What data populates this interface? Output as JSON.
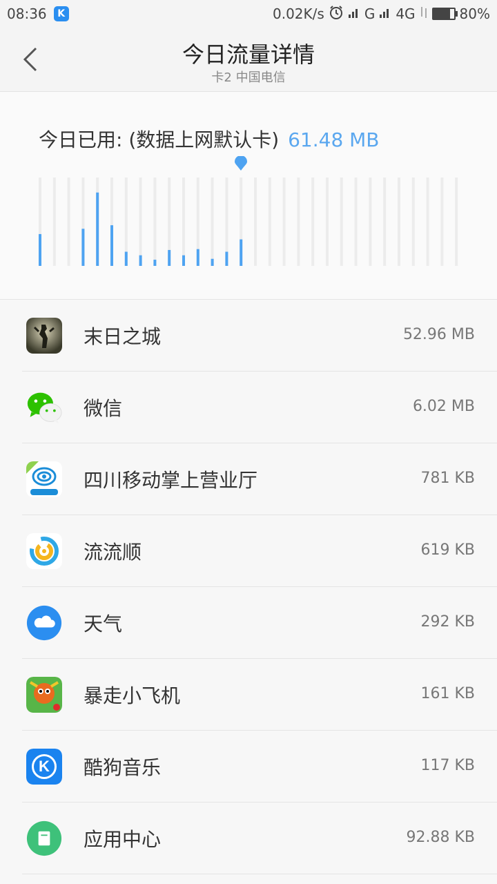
{
  "status": {
    "time": "08:36",
    "speed": "0.02K/s",
    "net1": "G",
    "net2": "4G",
    "battery": "80%"
  },
  "header": {
    "title": "今日流量详情",
    "subtitle": "卡2 中国电信"
  },
  "usage": {
    "label": "今日已用: (数据上网默认卡)",
    "value": "61.48 MB",
    "accent": "#4ea3f1"
  },
  "chart_data": {
    "type": "bar",
    "values": [
      0.36,
      0,
      0,
      0.42,
      0.83,
      0.46,
      0.16,
      0.12,
      0.07,
      0.18,
      0.12,
      0.19,
      0.08,
      0.16,
      0.3,
      0,
      0,
      0,
      0,
      0,
      0,
      0,
      0,
      0,
      0,
      0,
      0,
      0,
      0,
      0
    ],
    "current_index": 14
  },
  "apps": [
    {
      "name": "末日之城",
      "size": "52.96 MB",
      "icon": "zombie-game-icon"
    },
    {
      "name": "微信",
      "size": "6.02 MB",
      "icon": "wechat-icon"
    },
    {
      "name": "四川移动掌上营业厅",
      "size": "781 KB",
      "icon": "sichuan-mobile-icon",
      "icon_caption": "移动营业厅"
    },
    {
      "name": "流流顺",
      "size": "619 KB",
      "icon": "liuliushun-icon"
    },
    {
      "name": "天气",
      "size": "292 KB",
      "icon": "weather-cloud-icon"
    },
    {
      "name": "暴走小飞机",
      "size": "161 KB",
      "icon": "plane-game-icon"
    },
    {
      "name": "酷狗音乐",
      "size": "117 KB",
      "icon": "kugou-icon",
      "icon_letter": "K"
    },
    {
      "name": "应用中心",
      "size": "92.88 KB",
      "icon": "app-center-icon"
    }
  ]
}
